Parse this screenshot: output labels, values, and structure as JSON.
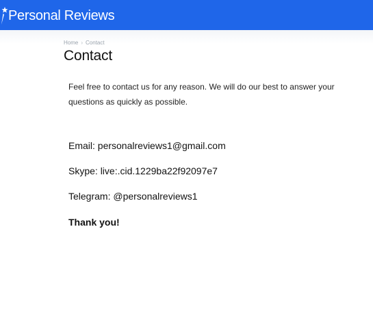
{
  "header": {
    "logo_text": "Personal Reviews",
    "brand_color": "#1f66e9"
  },
  "breadcrumb": {
    "home": "Home",
    "separator": "›",
    "current": "Contact"
  },
  "page": {
    "title": "Contact",
    "intro": "Feel free to contact us for any reason. We will do our best to answer your questions as quickly as possible.",
    "email": "Email: personalreviews1@gmail.com",
    "skype": "Skype: live:.cid.1229ba22f92097e7",
    "telegram": "Telegram: @personalreviews1",
    "thanks": "Thank you!"
  }
}
